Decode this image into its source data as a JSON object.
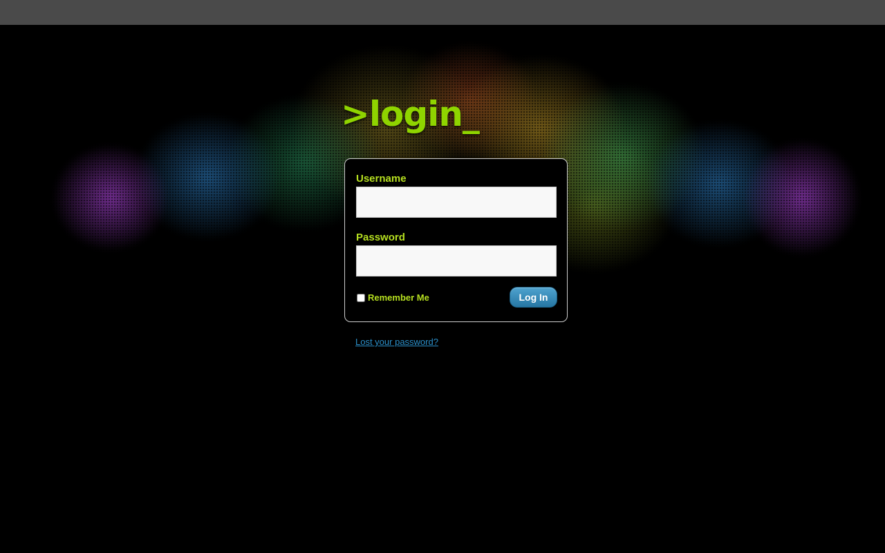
{
  "logo": {
    "text": ">login_"
  },
  "form": {
    "username_label": "Username",
    "username_value": "",
    "password_label": "Password",
    "password_value": "",
    "remember_label": "Remember Me",
    "remember_checked": false,
    "submit_label": "Log In"
  },
  "links": {
    "lost_password": "Lost your password?"
  },
  "colors": {
    "accent_green": "#8fd400",
    "label_green": "#b6e020",
    "button_blue": "#2676a3",
    "link_blue": "#2b8fc9",
    "background": "#000000",
    "topbar": "#4a4a4a"
  }
}
